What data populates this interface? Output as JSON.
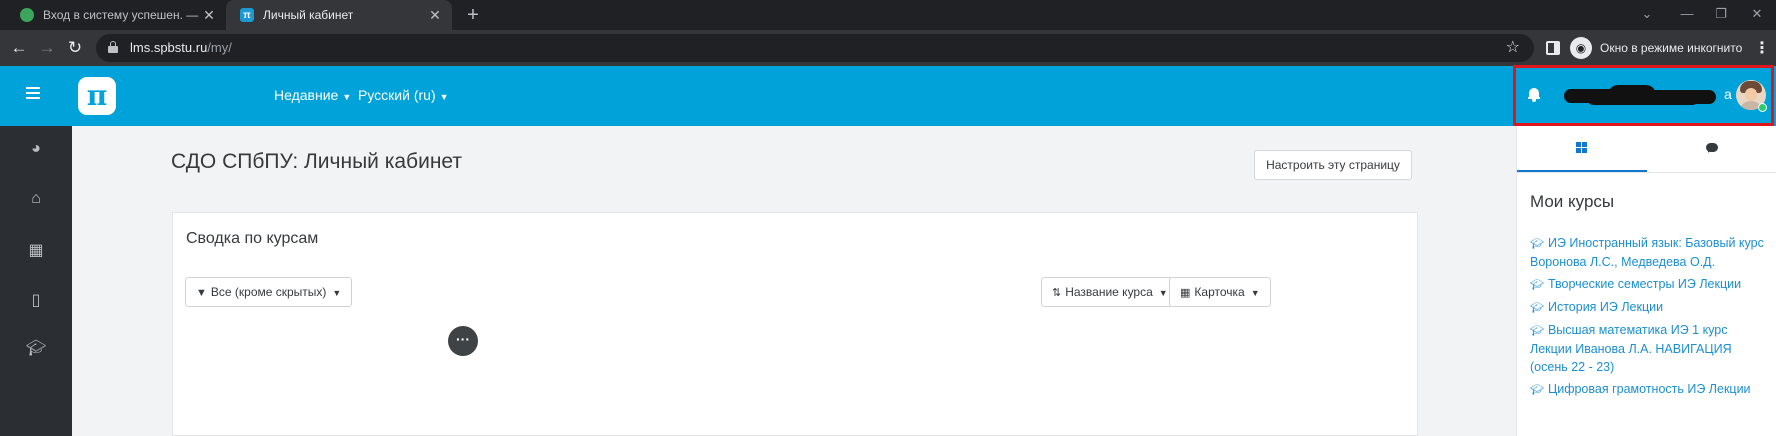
{
  "browser": {
    "tabs": [
      {
        "title": "Вход в систему успешен. — SSO",
        "active": false
      },
      {
        "title": "Личный кабинет",
        "active": true
      }
    ],
    "url_host": "lms.spbstu.ru",
    "url_path": "/my/",
    "incognito_label": "Окно в режиме инкогнито"
  },
  "navbar": {
    "logo_text": "π",
    "menu": [
      "Недавние",
      "Русский (ru)"
    ],
    "user_name_tail": "а"
  },
  "drawer": {
    "items": [
      "dashboard",
      "home",
      "calendar",
      "files",
      "courses"
    ]
  },
  "main": {
    "page_title": "СДО СПбПУ: Личный кабинет",
    "customize_label": "Настроить эту страницу",
    "overview": {
      "title": "Сводка по курсам",
      "filter_label": "Все (кроме скрытых)",
      "sort_label": "Название курса",
      "view_label": "Карточка"
    }
  },
  "right_block": {
    "title": "Мои курсы",
    "courses": [
      "ИЭ Иностранный язык: Базовый курс Воронова Л.С., Медведева О.Д.",
      "Творческие семестры ИЭ Лекции",
      "История ИЭ Лекции",
      "Высшая математика ИЭ 1 курс Лекции Иванова Л.А. НАВИГАЦИЯ (осень 22 - 23)",
      "Цифровая грамотность ИЭ Лекции"
    ]
  },
  "colors": {
    "navbar": "#00a3d9",
    "drawer": "#2b2f33",
    "link": "#1a8fd6",
    "highlight": "#e0161e"
  }
}
